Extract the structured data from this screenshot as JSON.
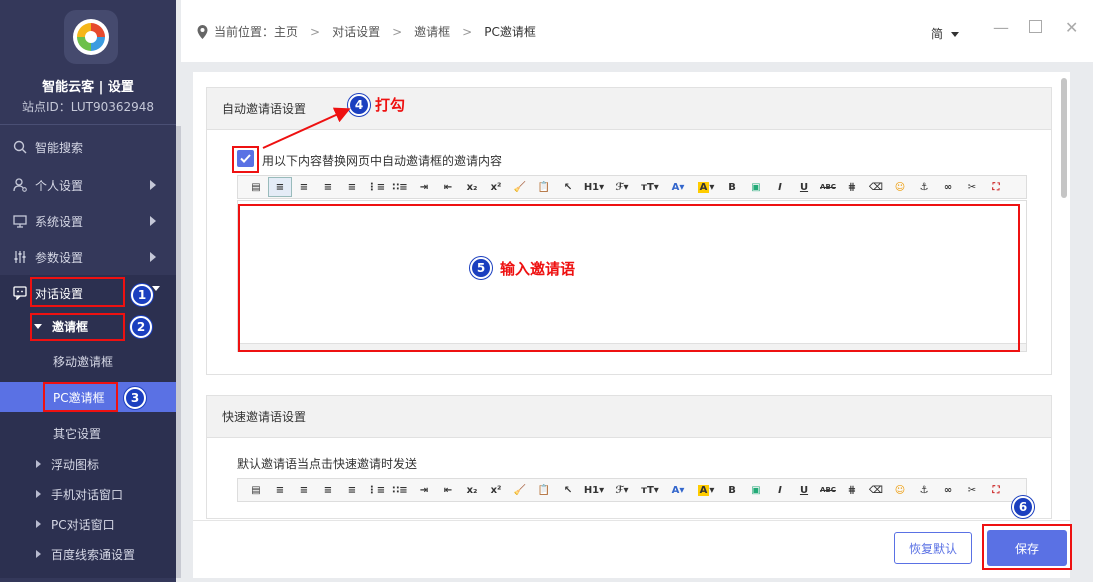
{
  "sidebar": {
    "brand": "智能云客 | 设置",
    "site_id": "站点ID：LUT90362948",
    "items": [
      {
        "label": "智能搜索"
      },
      {
        "label": "个人设置"
      },
      {
        "label": "系统设置"
      },
      {
        "label": "参数设置"
      },
      {
        "label": "对话设置"
      }
    ],
    "sub": {
      "group": "邀请框",
      "mobile": "移动邀请框",
      "pc": "PC邀请框",
      "other": "其它设置",
      "float": "浮动图标",
      "phone_chat": "手机对话窗口",
      "pc_chat": "PC对话窗口",
      "baidu": "百度线索通设置"
    }
  },
  "breadcrumb": {
    "prefix": "当前位置：主页",
    "c1": "对话设置",
    "c2": "邀请框",
    "c3": "PC邀请框"
  },
  "lang": "简",
  "panel1": {
    "title": "自动邀请语设置",
    "checkbox_label": "用以下内容替换网页中自动邀请框的邀请内容"
  },
  "panel2": {
    "title": "快速邀请语设置",
    "desc": "默认邀请语当点击快速邀请时发送"
  },
  "annotations": {
    "check": "打勾",
    "input": "输入邀请语"
  },
  "badges": [
    "1",
    "2",
    "3",
    "4",
    "5",
    "6"
  ],
  "buttons": {
    "reset": "恢复默认",
    "save": "保存"
  },
  "colors": {
    "sidebar": "#34385a",
    "accent": "#5a71e4",
    "annotation": "#e11111"
  }
}
